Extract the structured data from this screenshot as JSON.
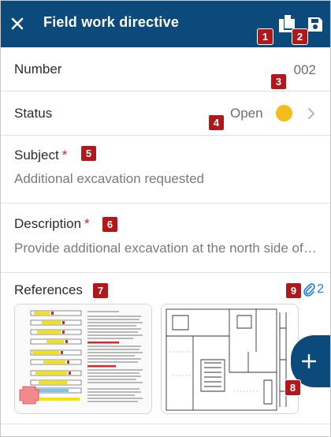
{
  "header": {
    "title": "Field work directive",
    "background": "#0b4a7a"
  },
  "form": {
    "number_label": "Number",
    "number_value": "002",
    "status_label": "Status",
    "status_value": "Open",
    "status_color": "#f2bd18",
    "subject_label": "Subject",
    "subject_value": "Additional excavation requested",
    "description_label": "Description",
    "description_value": "Provide additional excavation at the north side of the site",
    "required_mark": "*",
    "references_label": "References",
    "attachments_count": "2"
  },
  "callouts": [
    "1",
    "2",
    "3",
    "4",
    "5",
    "6",
    "7",
    "8",
    "9"
  ],
  "icons": {
    "close": "close-icon",
    "copy": "copy-icon",
    "save": "save-icon",
    "chevron": "chevron-right-icon",
    "attachment": "paperclip-icon",
    "add": "plus-icon"
  }
}
